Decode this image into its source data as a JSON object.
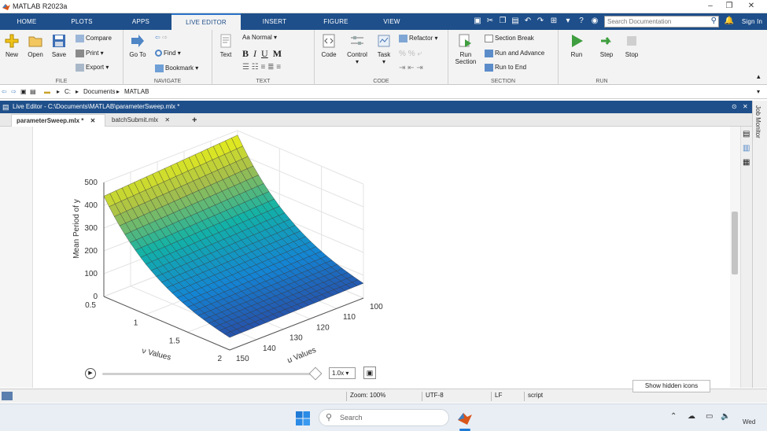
{
  "window": {
    "title": "MATLAB R2023a",
    "min": "–",
    "restore": "❐",
    "close": "✕"
  },
  "ribbon_tabs": [
    {
      "label": "HOME"
    },
    {
      "label": "PLOTS"
    },
    {
      "label": "APPS"
    },
    {
      "label": "LIVE EDITOR"
    },
    {
      "label": "INSERT"
    },
    {
      "label": "FIGURE"
    },
    {
      "label": "VIEW"
    }
  ],
  "search": {
    "placeholder": "Search Documentation"
  },
  "sign_in": "Sign In",
  "toolstrip": {
    "file": {
      "label": "FILE",
      "new": "New",
      "open": "Open",
      "save": "Save",
      "compare": "Compare",
      "print": "Print",
      "export": "Export"
    },
    "navigate": {
      "label": "NAVIGATE",
      "goto": "Go To",
      "find": "Find",
      "bookmark": "Bookmark"
    },
    "text": {
      "label": "TEXT",
      "text": "Text",
      "style": "Normal",
      "bold": "B",
      "italic": "I",
      "underline": "U",
      "mono": "M"
    },
    "code": {
      "label": "CODE",
      "code": "Code",
      "control": "Control",
      "task": "Task",
      "refactor": "Refactor"
    },
    "section": {
      "label": "SECTION",
      "run_section": "Run Section",
      "section_break": "Section Break",
      "run_and_advance": "Run and Advance",
      "run_to_end": "Run to End"
    },
    "run": {
      "label": "RUN",
      "run": "Run",
      "step": "Step",
      "stop": "Stop"
    }
  },
  "address": {
    "drive": "C:",
    "p1": "Documents",
    "p2": "MATLAB"
  },
  "live_editor": {
    "title": "Live Editor - C:\\Documents\\MATLAB\\parameterSweep.mlx *"
  },
  "file_tabs": [
    {
      "label": "parameterSweep.mlx *"
    },
    {
      "label": "batchSubmit.mlx"
    }
  ],
  "add_tab": "+",
  "job_monitor": "Job Monitor",
  "chart_data": {
    "type": "surface",
    "zlabel": "Mean Period of  y",
    "xlabel": "ν Values",
    "ylabel": "μ Values",
    "x_ticks": [
      "0.5",
      "1",
      "1.5",
      "2"
    ],
    "y_ticks": [
      "100",
      "110",
      "120",
      "130",
      "140",
      "150"
    ],
    "z_ticks": [
      "0",
      "100",
      "200",
      "300",
      "400",
      "500"
    ],
    "xlim": [
      0.5,
      2
    ],
    "ylim": [
      100,
      150
    ],
    "zlim": [
      0,
      500
    ],
    "colormap": "parula",
    "surface_model": "z decays with ν from ~480 at ν=0.5 to ~60 at ν=2, slight decrease with μ",
    "corner_values": {
      "nu0.5_mu100": 480,
      "nu0.5_mu150": 440,
      "nu2_mu100": 65,
      "nu2_mu150": 55
    }
  },
  "animation": {
    "speed": "1.0x"
  },
  "status": {
    "zoom": "Zoom: 100%",
    "encoding": "UTF-8",
    "eol": "LF",
    "mode": "script"
  },
  "tooltip": "Show hidden icons",
  "taskbar": {
    "search": "Search",
    "day": "Wed"
  }
}
